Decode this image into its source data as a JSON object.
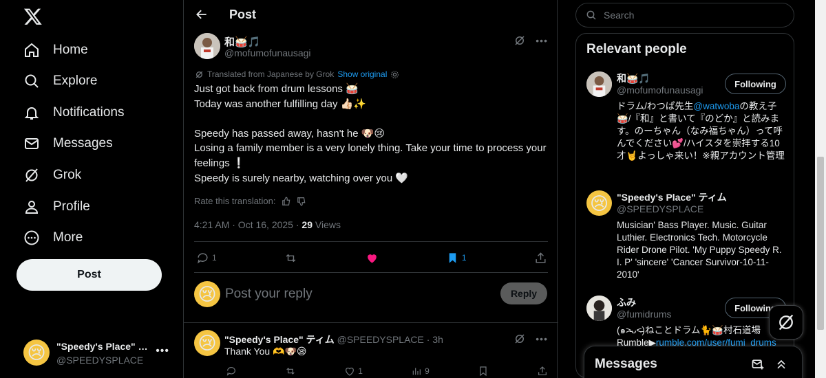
{
  "nav": {
    "items": [
      {
        "label": "Home",
        "icon": "home-icon"
      },
      {
        "label": "Explore",
        "icon": "search-icon"
      },
      {
        "label": "Notifications",
        "icon": "bell-icon"
      },
      {
        "label": "Messages",
        "icon": "mail-icon"
      },
      {
        "label": "Grok",
        "icon": "grok-icon"
      },
      {
        "label": "Profile",
        "icon": "person-icon"
      },
      {
        "label": "More",
        "icon": "more-circle-icon"
      }
    ],
    "post_label": "Post"
  },
  "account": {
    "name": "\"Speedy's Place\" ティム",
    "handle": "@SPEEDYSPLACE"
  },
  "header": {
    "title": "Post"
  },
  "post": {
    "author_name": "和🥁🎵",
    "author_handle": "@mofumofunausagi",
    "translated_label": "Translated from Japanese by Grok",
    "show_original": "Show original",
    "lines": [
      "Just got back from drum lessons 🥁",
      "Today was another fulfilling day 👍🏻✨",
      "",
      "Speedy has passed away, hasn't he 🐶😢",
      "Losing a family member is a very lonely thing. Take your time to process your feelings ❕",
      "Speedy is surely nearby, watching over you 🤍"
    ],
    "rate_label": "Rate this translation:",
    "time": "4:21 AM · Oct 16, 2025 · ",
    "views_count": "29",
    "views_label": " Views",
    "replies": "1",
    "likes": "",
    "bookmarks": "1"
  },
  "reply_box": {
    "placeholder": "Post your reply",
    "button": "Reply"
  },
  "reply": {
    "name": "\"Speedy's Place\" ティム",
    "handle_time": " @SPEEDYSPLACE · 3h",
    "text": "Thank You 🫶🐶😪",
    "replies": "",
    "retweets": "",
    "likes": "1",
    "views": "9"
  },
  "right": {
    "search_placeholder": "Search",
    "relevant_title": "Relevant people",
    "people": [
      {
        "name": "和🥁🎵",
        "handle": "@mofumofunausagi",
        "button": "Following",
        "bio_pre": "ドラム/わつぱ先生",
        "bio_link": "@watwoba",
        "bio_post": "の教え子🥁/『和』と書いて『のどか』と読みます。のーちゃん（なみ福ちゃん）って呼んでください💕/ハイスタを崇拝する10才🤘よっしゃ来い！※親アカウント管理"
      },
      {
        "name": "\"Speedy's Place\" ティム",
        "handle": "@SPEEDYSPLACE",
        "bio": "Musician' Bass Player. Music. Guitar Luthier. Electronics Tech. Motorcycle Rider Drone Pilot. 'My Puppy Speedy R. I. P' 'sincere' 'Cancer Survivor-10-11-2010'"
      },
      {
        "name": "ふみ",
        "handle": "@fumidrums",
        "button": "Following",
        "bio_pre": "(๑˃̵ᴗ˂̵)ねことドラム🐈🥁村石道場 Rumble▶",
        "bio_link": "rumble.com/user/fumi_drums"
      }
    ]
  },
  "messages": {
    "title": "Messages"
  },
  "colors": {
    "accent": "#1d9bf0",
    "like": "#f91880",
    "background": "#000000"
  }
}
